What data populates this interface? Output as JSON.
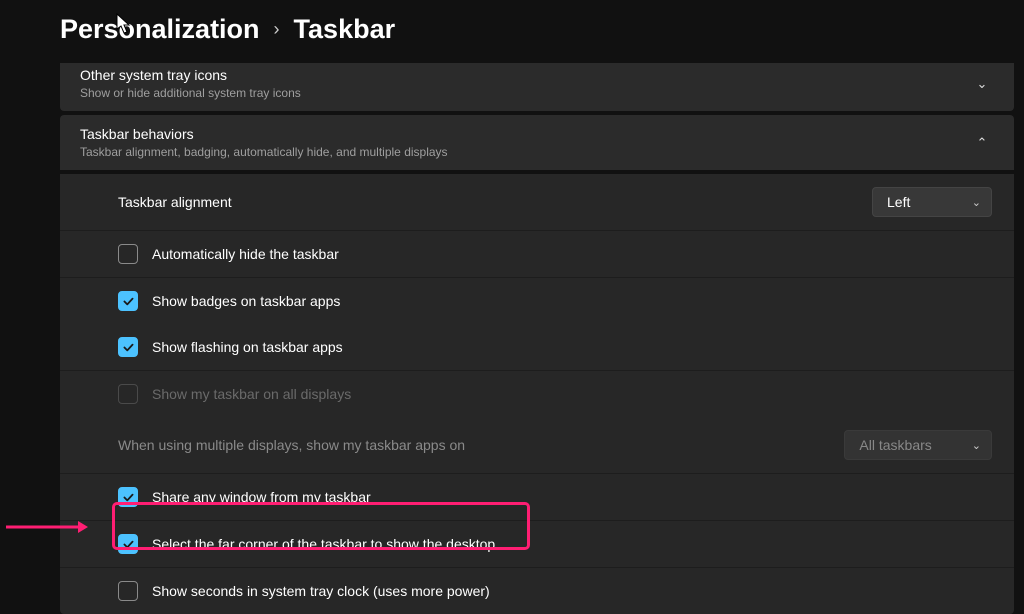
{
  "breadcrumb": {
    "parent": "Personalization",
    "current": "Taskbar"
  },
  "sections": {
    "other_tray": {
      "title": "Other system tray icons",
      "subtitle": "Show or hide additional system tray icons"
    },
    "behaviors": {
      "title": "Taskbar behaviors",
      "subtitle": "Taskbar alignment, badging, automatically hide, and multiple displays"
    }
  },
  "rows": {
    "alignment": {
      "label": "Taskbar alignment",
      "value": "Left"
    },
    "autohide": {
      "label": "Automatically hide the taskbar",
      "checked": false
    },
    "badges": {
      "label": "Show badges on taskbar apps",
      "checked": true
    },
    "flashing": {
      "label": "Show flashing on taskbar apps",
      "checked": true
    },
    "all_displays": {
      "label": "Show my taskbar on all displays",
      "checked": false,
      "disabled": true
    },
    "multi_label": {
      "label": "When using multiple displays, show my taskbar apps on",
      "value": "All taskbars",
      "disabled": true
    },
    "share_window": {
      "label": "Share any window from my taskbar",
      "checked": true
    },
    "far_corner": {
      "label": "Select the far corner of the taskbar to show the desktop",
      "checked": true
    },
    "seconds": {
      "label": "Show seconds in system tray clock (uses more power)",
      "checked": false
    }
  }
}
